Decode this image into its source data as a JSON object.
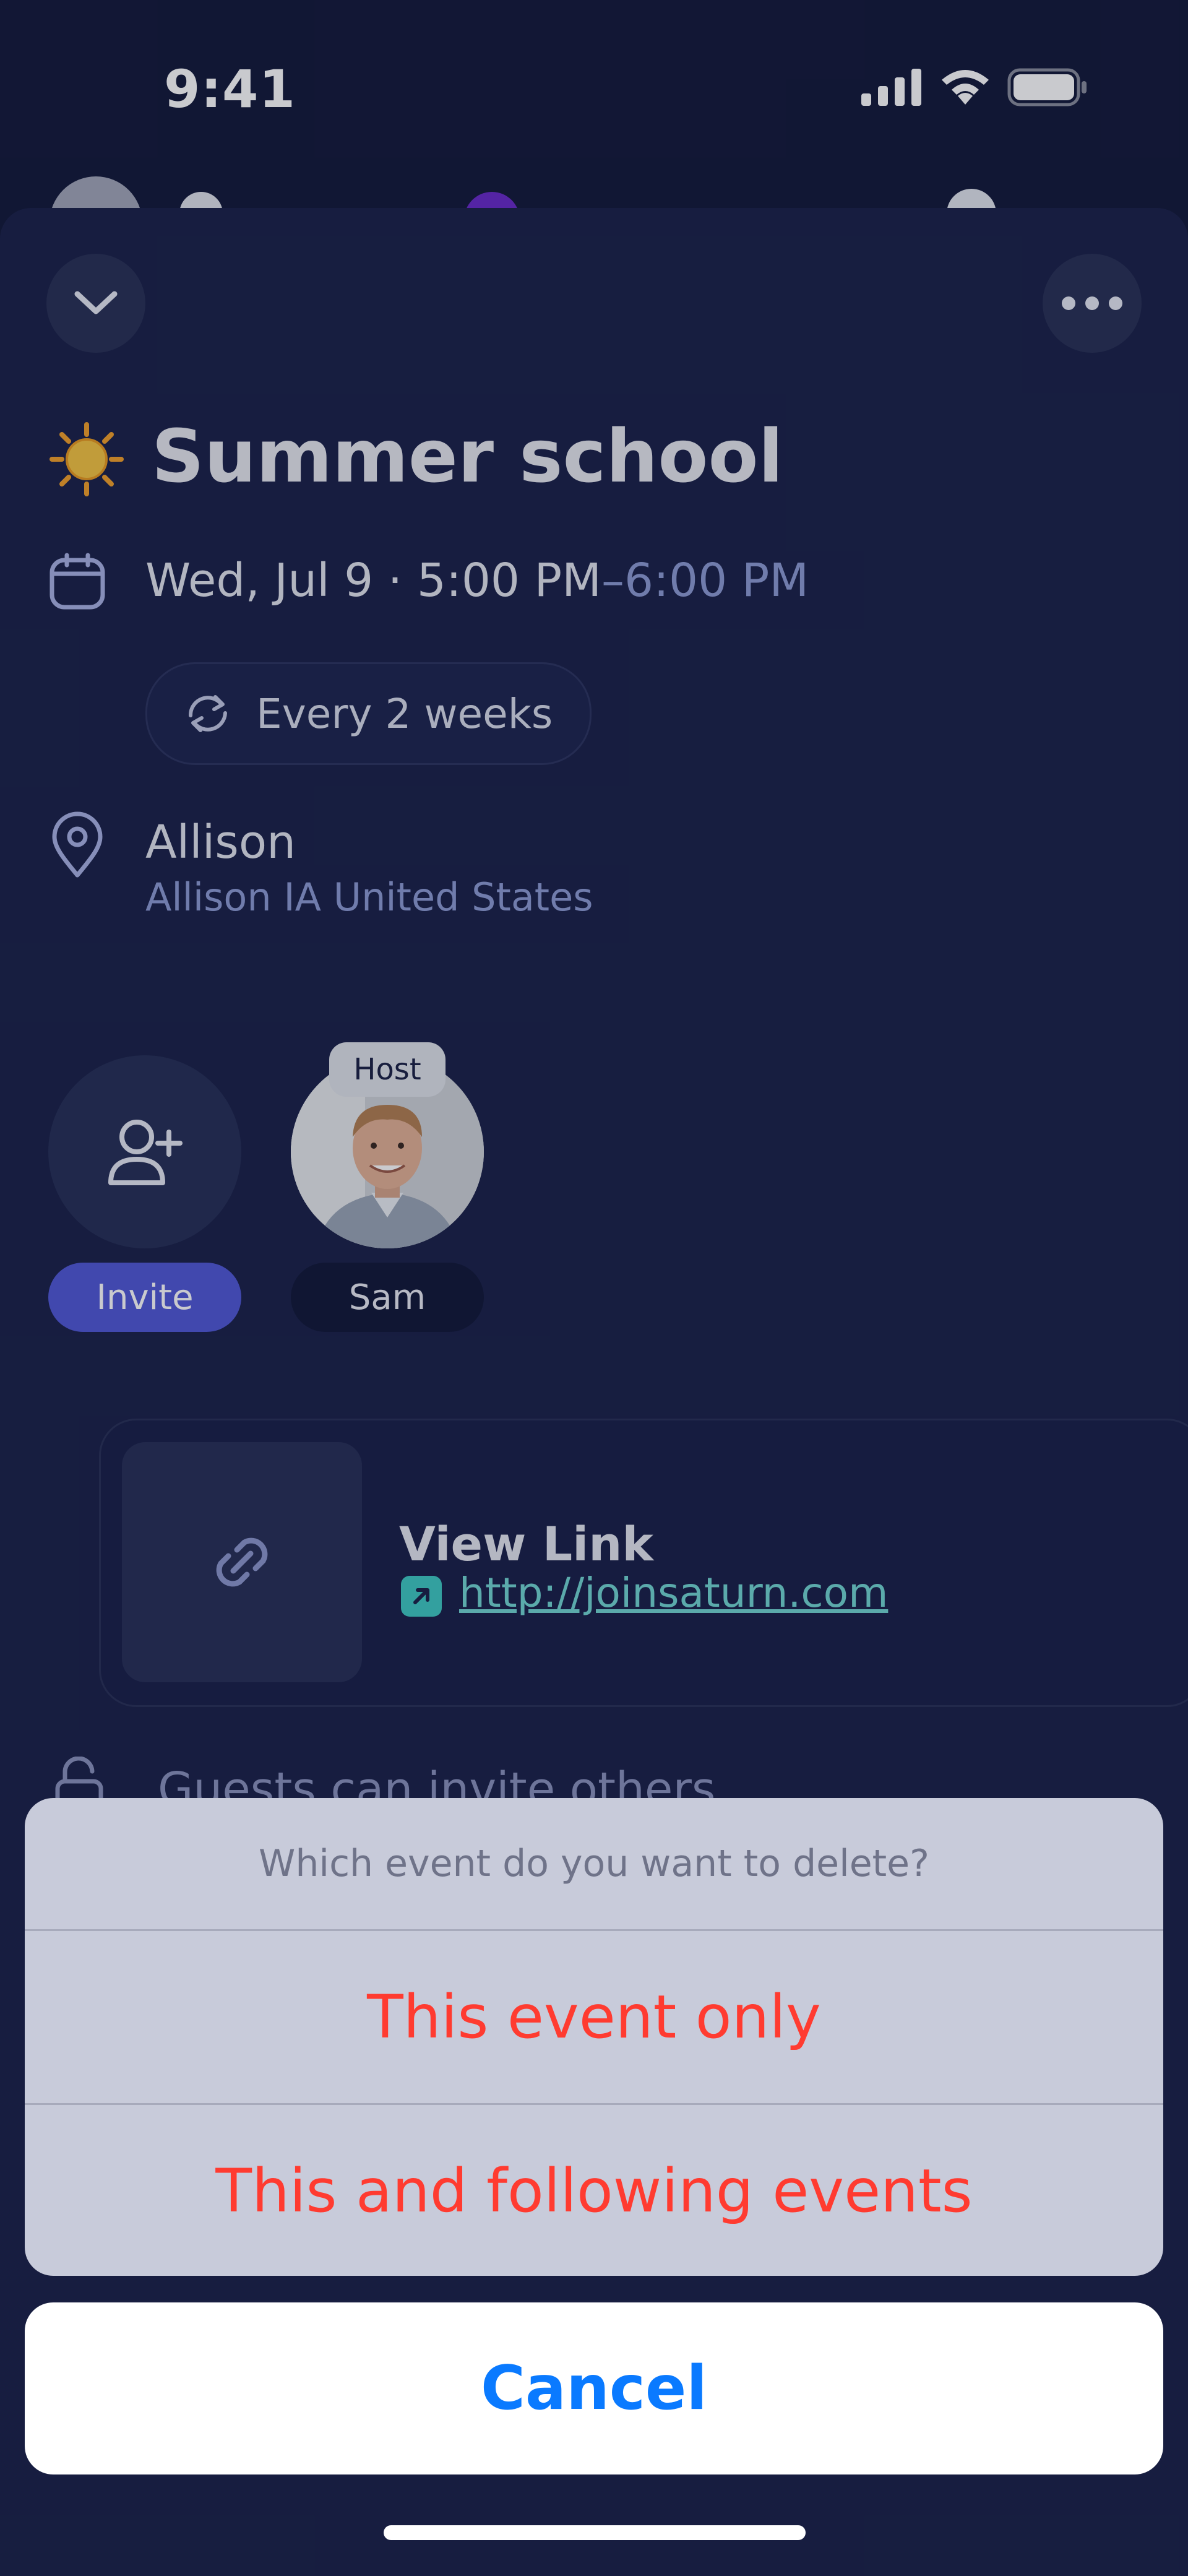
{
  "status_bar": {
    "time": "9:41"
  },
  "event": {
    "emoji_icon": "sun-icon",
    "title": "Summer school",
    "date_start": "Wed, Jul 9 · 5:00 PM",
    "date_end": "–6:00 PM",
    "recurrence": "Every 2 weeks",
    "location_name": "Allison",
    "location_address": "Allison IA United States"
  },
  "people": {
    "invite_label": "Invite",
    "host_badge": "Host",
    "host_name": "Sam"
  },
  "link": {
    "title": "View Link",
    "url": "http://joinsaturn.com"
  },
  "permissions": {
    "guests_invite": "Guests can invite others"
  },
  "action_sheet": {
    "header": "Which event do you want to delete?",
    "option_1": "This event only",
    "option_2": "This and following events",
    "cancel": "Cancel"
  },
  "colors": {
    "sheet_bg": "#1b2249",
    "invite_accent": "#5159d6",
    "destructive": "#ff3b30",
    "cancel_blue": "#0a7aff",
    "link_teal": "#72d6d2"
  }
}
